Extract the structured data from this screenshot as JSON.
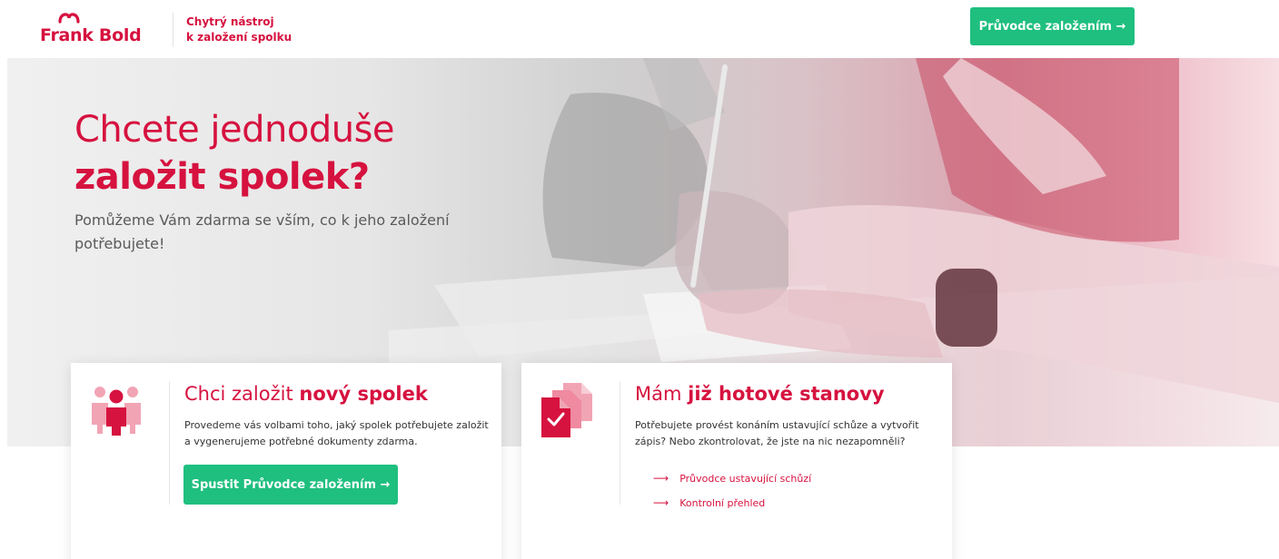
{
  "brand": {
    "name": "Frank Bold",
    "tagline_line1": "Chytrý nástroj",
    "tagline_line2": "k založení spolku",
    "color": "#d6123f"
  },
  "header": {
    "cta_label": "Průvodce založením →"
  },
  "hero": {
    "title_light": "Chcete jednoduše",
    "title_bold": "založit spolek?",
    "subtitle": "Pomůžeme Vám zdarma se vším, co k jeho založení potřebujete!"
  },
  "cards": [
    {
      "icon": "people-group-icon",
      "title_prefix": "Chci založit ",
      "title_bold": "nový spolek",
      "description": "Provedeme vás volbami toho, jaký spolek potřebujete založit a vygenerujeme potřebné dokumenty zdarma.",
      "button_label": "Spustit Průvodce založením →"
    },
    {
      "icon": "document-check-icon",
      "title_prefix": "Mám ",
      "title_bold": "již hotové stanovy",
      "description": "Potřebujete provést konáním ustavující schůze a vytvořit zápis? Nebo zkontrolovat, že jste na nic nezapomněli?",
      "links": [
        {
          "arrow": "⟶",
          "label": "Průvodce ustavující schůzí"
        },
        {
          "arrow": "⟶",
          "label": "Kontrolní přehled"
        }
      ]
    }
  ],
  "colors": {
    "accent_red": "#d6123f",
    "accent_green": "#1fbf7f"
  }
}
